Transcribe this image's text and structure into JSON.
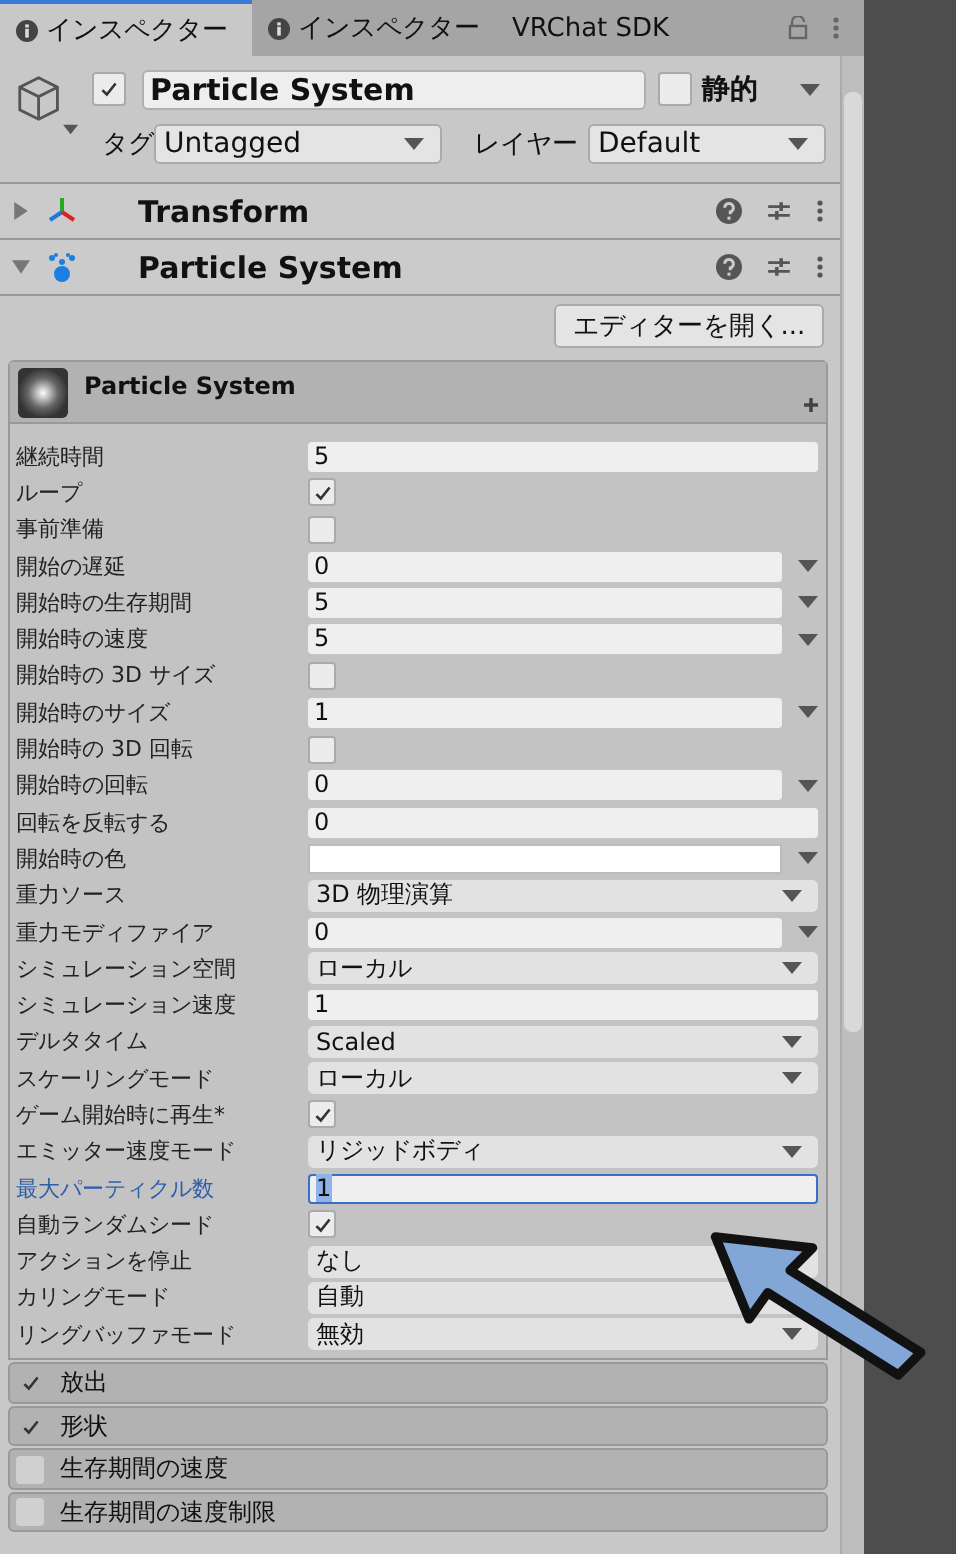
{
  "tabs": [
    {
      "label": "インスペクター",
      "icon": true,
      "selected": true
    },
    {
      "label": "インスペクター",
      "icon": true,
      "selected": false
    },
    {
      "label": "VRChat SDK",
      "icon": false,
      "selected": false
    }
  ],
  "object": {
    "active": true,
    "name": "Particle System",
    "static": false,
    "static_label": "静的",
    "tag_label": "タグ",
    "tag": "Untagged",
    "layer_label": "レイヤー",
    "layer": "Default"
  },
  "components": [
    {
      "name": "Transform",
      "expanded": false,
      "kind": "transform"
    },
    {
      "name": "Particle System",
      "expanded": true,
      "kind": "particles"
    }
  ],
  "editor_button": "エディターを開く...",
  "module_title": "Particle System",
  "properties": [
    {
      "label": "継続時間",
      "kind": "field",
      "value": "5",
      "curve": false
    },
    {
      "label": "ループ",
      "kind": "check",
      "checked": true
    },
    {
      "label": "事前準備",
      "kind": "check",
      "checked": false
    },
    {
      "label": "開始の遅延",
      "kind": "field",
      "value": "0",
      "curve": true
    },
    {
      "label": "開始時の生存期間",
      "kind": "field",
      "value": "5",
      "curve": true
    },
    {
      "label": "開始時の速度",
      "kind": "field",
      "value": "5",
      "curve": true
    },
    {
      "label": "開始時の 3D サイズ",
      "kind": "check",
      "checked": false
    },
    {
      "label": "開始時のサイズ",
      "kind": "field",
      "value": "1",
      "curve": true
    },
    {
      "label": "開始時の 3D 回転",
      "kind": "check",
      "checked": false
    },
    {
      "label": "開始時の回転",
      "kind": "field",
      "value": "0",
      "curve": true
    },
    {
      "label": "回転を反転する",
      "kind": "field",
      "value": "0",
      "curve": false
    },
    {
      "label": "開始時の色",
      "kind": "color",
      "color": "#ffffff",
      "curve": true
    },
    {
      "label": "重力ソース",
      "kind": "dropdown",
      "value": "3D 物理演算"
    },
    {
      "label": "重力モディファイア",
      "kind": "field",
      "value": "0",
      "curve": true
    },
    {
      "label": "シミュレーション空間",
      "kind": "dropdown",
      "value": "ローカル"
    },
    {
      "label": "シミュレーション速度",
      "kind": "field",
      "value": "1",
      "curve": false
    },
    {
      "label": "デルタタイム",
      "kind": "dropdown",
      "value": "Scaled"
    },
    {
      "label": "スケーリングモード",
      "kind": "dropdown",
      "value": "ローカル"
    },
    {
      "label": "ゲーム開始時に再生*",
      "kind": "check",
      "checked": true
    },
    {
      "label": "エミッター速度モード",
      "kind": "dropdown",
      "value": "リジッドボディ"
    },
    {
      "label": "最大パーティクル数",
      "kind": "field",
      "value": "1",
      "curve": false,
      "focused": true
    },
    {
      "label": "自動ランダムシード",
      "kind": "check",
      "checked": true
    },
    {
      "label": "アクションを停止",
      "kind": "dropdown",
      "value": "なし"
    },
    {
      "label": "カリングモード",
      "kind": "dropdown",
      "value": "自動"
    },
    {
      "label": "リングバッファモード",
      "kind": "dropdown",
      "value": "無効"
    }
  ],
  "modules": [
    {
      "label": "放出",
      "enabled": true
    },
    {
      "label": "形状",
      "enabled": true
    },
    {
      "label": "生存期間の速度",
      "enabled": false
    },
    {
      "label": "生存期間の速度制限",
      "enabled": false
    }
  ]
}
